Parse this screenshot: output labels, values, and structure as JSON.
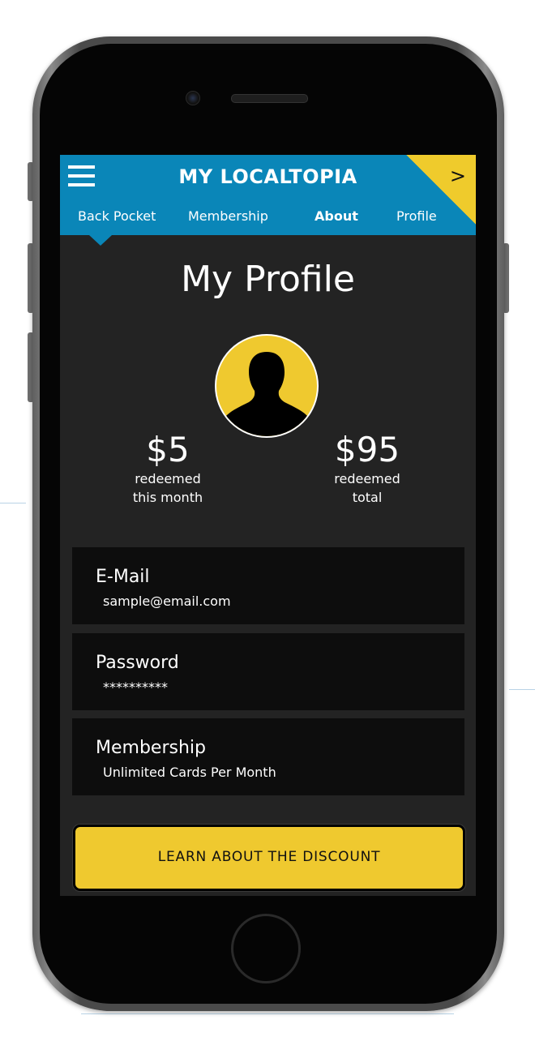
{
  "header": {
    "title": "MY LOCALTOPIA",
    "corner_arrow": ">",
    "tabs": [
      {
        "label": "Back Pocket",
        "active": false
      },
      {
        "label": "Membership",
        "active": false
      },
      {
        "label": "About",
        "active": true
      },
      {
        "label": "Profile",
        "active": false
      }
    ]
  },
  "page": {
    "title": "My Profile"
  },
  "stats": {
    "month": {
      "amount": "$5",
      "line1": "redeemed",
      "line2": "this month"
    },
    "total": {
      "amount": "$95",
      "line1": "redeemed",
      "line2": "total"
    }
  },
  "fields": [
    {
      "label": "E-Mail",
      "value": "sample@email.com"
    },
    {
      "label": "Password",
      "value": "**********"
    },
    {
      "label": "Membership",
      "value": "Unlimited Cards Per Month"
    }
  ],
  "cta": {
    "label": "LEARN ABOUT THE DISCOUNT"
  },
  "colors": {
    "header_blue": "#0a86b8",
    "accent_yellow": "#efc92f",
    "screen_bg": "#232323",
    "field_bg": "#0d0d0d"
  },
  "icons": {
    "menu": "hamburger-menu-icon",
    "avatar": "user-silhouette-icon"
  }
}
